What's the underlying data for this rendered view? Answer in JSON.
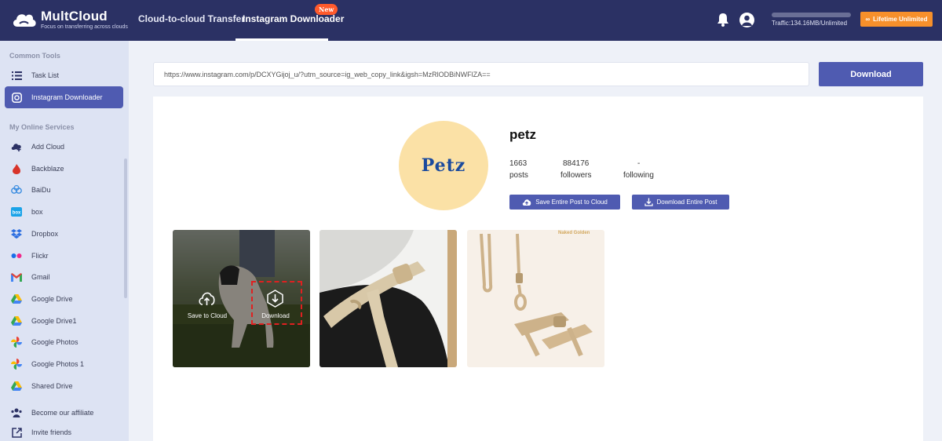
{
  "app": {
    "logo_title": "MultCloud",
    "logo_subtitle": "Focus on transferring across clouds"
  },
  "topnav": {
    "items": [
      "Cloud-to-cloud Transfer",
      "Instagram Downloader"
    ],
    "new_badge": "New",
    "traffic": "Traffic:134.16MB/Unlimited",
    "lifetime_label": "Lifetime Unlimited"
  },
  "sidebar": {
    "common_heading": "Common Tools",
    "common_items": [
      {
        "label": "Task List",
        "icon": "list-icon"
      },
      {
        "label": "Instagram Downloader",
        "icon": "instagram-icon",
        "active": true
      }
    ],
    "services_heading": "My Online Services",
    "services": [
      {
        "label": "Add Cloud",
        "icon": "add-cloud-icon"
      },
      {
        "label": "Backblaze",
        "icon": "backblaze-icon"
      },
      {
        "label": "BaiDu",
        "icon": "baidu-icon"
      },
      {
        "label": "box",
        "icon": "box-icon"
      },
      {
        "label": "Dropbox",
        "icon": "dropbox-icon"
      },
      {
        "label": "Flickr",
        "icon": "flickr-icon"
      },
      {
        "label": "Gmail",
        "icon": "gmail-icon"
      },
      {
        "label": "Google Drive",
        "icon": "google-drive-icon"
      },
      {
        "label": "Google Drive1",
        "icon": "google-drive-icon"
      },
      {
        "label": "Google Photos",
        "icon": "google-photos-icon"
      },
      {
        "label": "Google Photos 1",
        "icon": "google-photos-icon"
      },
      {
        "label": "Shared Drive",
        "icon": "shared-drive-icon"
      }
    ],
    "bottom_items": [
      {
        "label": "Become our affiliate",
        "icon": "affiliate-icon"
      },
      {
        "label": "Invite friends",
        "icon": "invite-icon"
      }
    ]
  },
  "main": {
    "url_value": "https://www.instagram.com/p/DCXYGijoj_u/?utm_source=ig_web_copy_link&igsh=MzRlODBiNWFlZA==",
    "download_button": "Download",
    "profile": {
      "avatar_text": "Petz",
      "username": "petz",
      "posts_count": "1663",
      "posts_label": "posts",
      "followers_count": "884176",
      "followers_label": "followers",
      "following_count": "-",
      "following_label": "following"
    },
    "save_entire_label": "Save Entire Post to Cloud",
    "download_entire_label": "Download Entire Post",
    "overlay": {
      "save_label": "Save to Cloud",
      "download_label": "Download"
    },
    "thumb3_caption": "Naked Golden"
  },
  "colors": {
    "topbar": "#2b3164",
    "accent": "#4f5bb1",
    "orange": "#f7902b",
    "badge": "#ff5a2c"
  }
}
